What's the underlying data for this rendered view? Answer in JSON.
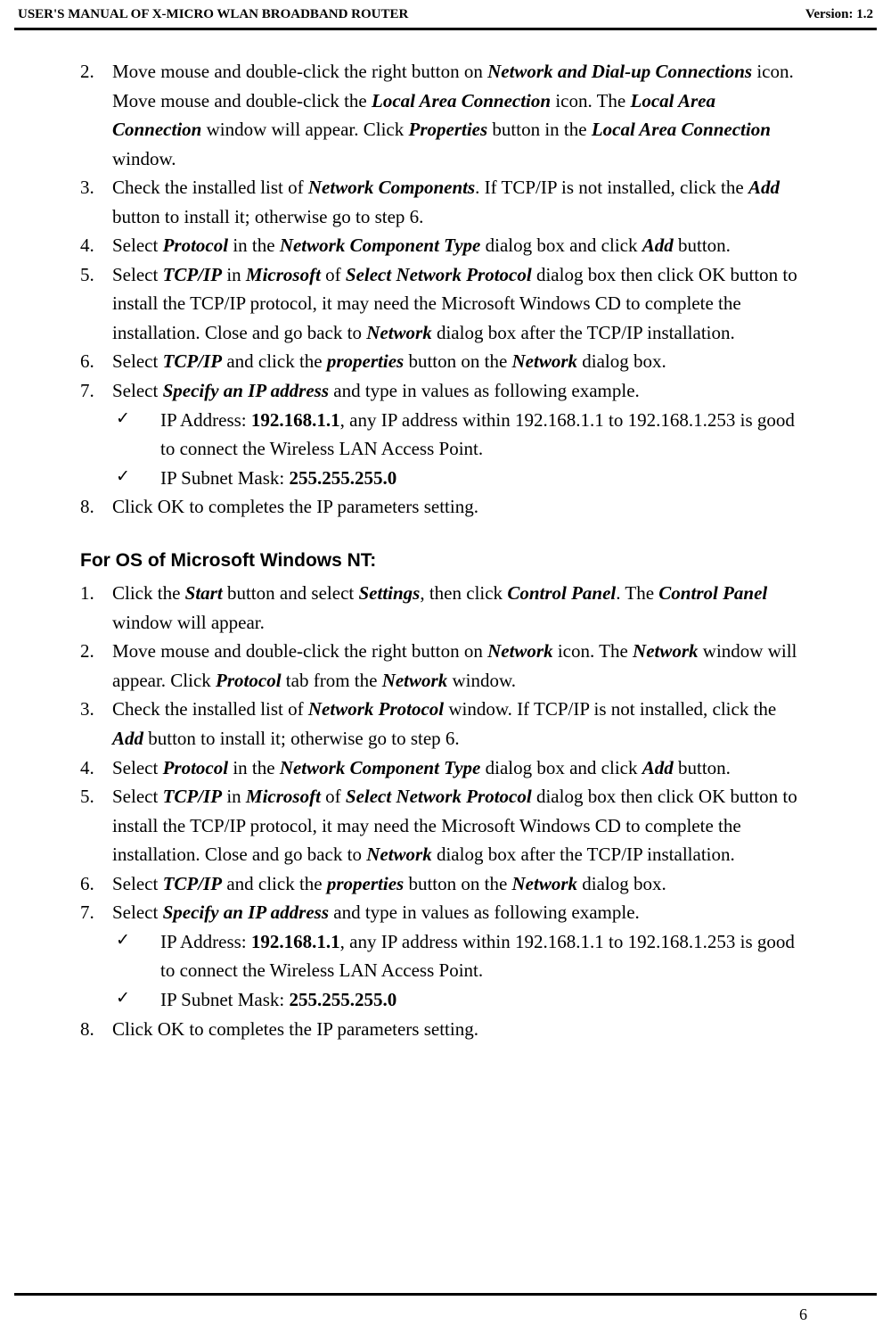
{
  "header": {
    "left": "USER'S MANUAL OF X-MICRO WLAN BROADBAND ROUTER",
    "right": "Version: 1.2"
  },
  "topList": {
    "items": [
      {
        "num": "2.",
        "parts": [
          {
            "t": "Move mouse and double-click the right button on "
          },
          {
            "t": "Network and Dial-up Connections",
            "bi": true
          },
          {
            "t": " icon. Move mouse and double-click the "
          },
          {
            "t": "Local Area Connection",
            "bi": true
          },
          {
            "t": " icon. The "
          },
          {
            "t": "Local Area Connection",
            "bi": true
          },
          {
            "t": " window will appear. Click "
          },
          {
            "t": "Properties",
            "bi": true
          },
          {
            "t": " button in the "
          },
          {
            "t": "Local Area Connection",
            "bi": true
          },
          {
            "t": " window."
          }
        ]
      },
      {
        "num": "3.",
        "parts": [
          {
            "t": "Check the installed list of "
          },
          {
            "t": "Network Components",
            "bi": true
          },
          {
            "t": ". If TCP/IP is not installed, click the "
          },
          {
            "t": "Add",
            "bi": true
          },
          {
            "t": " button to install it; otherwise go to step 6."
          }
        ]
      },
      {
        "num": "4.",
        "parts": [
          {
            "t": "Select "
          },
          {
            "t": "Protocol",
            "bi": true
          },
          {
            "t": " in the "
          },
          {
            "t": "Network Component Type",
            "bi": true
          },
          {
            "t": " dialog box and click "
          },
          {
            "t": "Add",
            "bi": true
          },
          {
            "t": " button."
          }
        ]
      },
      {
        "num": "5.",
        "parts": [
          {
            "t": "Select "
          },
          {
            "t": "TCP/IP",
            "bi": true
          },
          {
            "t": " in "
          },
          {
            "t": "Microsoft",
            "bi": true
          },
          {
            "t": " of "
          },
          {
            "t": "Select Network Protocol",
            "bi": true
          },
          {
            "t": " dialog box then click OK button to install the TCP/IP protocol, it may need the Microsoft Windows CD to complete the installation. Close and go back to "
          },
          {
            "t": "Network",
            "bi": true
          },
          {
            "t": " dialog box after the TCP/IP installation."
          }
        ]
      },
      {
        "num": "6.",
        "parts": [
          {
            "t": "Select "
          },
          {
            "t": "TCP/IP",
            "bi": true
          },
          {
            "t": " and click the "
          },
          {
            "t": "properties",
            "bi": true
          },
          {
            "t": " button on the "
          },
          {
            "t": "Network",
            "bi": true
          },
          {
            "t": " dialog box."
          }
        ]
      },
      {
        "num": "7.",
        "parts": [
          {
            "t": "Select "
          },
          {
            "t": "Specify an IP address",
            "bi": true
          },
          {
            "t": " and type in values as following example."
          }
        ],
        "sub": [
          {
            "parts": [
              {
                "t": "IP Address: "
              },
              {
                "t": "192.168.1.1",
                "b": true
              },
              {
                "t": ", any IP address within 192.168.1.1 to 192.168.1.253 is good to connect the Wireless LAN Access Point."
              }
            ]
          },
          {
            "parts": [
              {
                "t": "IP Subnet Mask: "
              },
              {
                "t": "255.255.255.0",
                "b": true
              }
            ]
          }
        ]
      },
      {
        "num": "8.",
        "parts": [
          {
            "t": "Click OK to completes the IP parameters setting."
          }
        ]
      }
    ]
  },
  "sectionTitle": "For OS of Microsoft Windows NT:",
  "ntList": {
    "items": [
      {
        "num": "1.",
        "parts": [
          {
            "t": "Click the "
          },
          {
            "t": "Start",
            "bi": true
          },
          {
            "t": " button and select "
          },
          {
            "t": "Settings",
            "bi": true
          },
          {
            "t": ", then click "
          },
          {
            "t": "Control Panel",
            "bi": true
          },
          {
            "t": ". The "
          },
          {
            "t": "Control Panel",
            "bi": true
          },
          {
            "t": " window will appear."
          }
        ]
      },
      {
        "num": "2.",
        "parts": [
          {
            "t": "Move mouse and double-click the right button on "
          },
          {
            "t": "Network",
            "bi": true
          },
          {
            "t": " icon. The "
          },
          {
            "t": "Network",
            "bi": true
          },
          {
            "t": " window will appear. Click "
          },
          {
            "t": "Protocol",
            "bi": true
          },
          {
            "t": " tab from the "
          },
          {
            "t": "Network",
            "bi": true
          },
          {
            "t": " window."
          }
        ]
      },
      {
        "num": "3.",
        "parts": [
          {
            "t": "Check the installed list of "
          },
          {
            "t": "Network Protocol",
            "bi": true
          },
          {
            "t": " window. If TCP/IP is not installed, click the "
          },
          {
            "t": "Add",
            "bi": true
          },
          {
            "t": " button to install it; otherwise go to step 6."
          }
        ]
      },
      {
        "num": "4.",
        "parts": [
          {
            "t": "Select "
          },
          {
            "t": "Protocol",
            "bi": true
          },
          {
            "t": " in the "
          },
          {
            "t": "Network Component Type",
            "bi": true
          },
          {
            "t": " dialog box and click "
          },
          {
            "t": "Add",
            "bi": true
          },
          {
            "t": " button."
          }
        ]
      },
      {
        "num": "5.",
        "parts": [
          {
            "t": "Select "
          },
          {
            "t": "TCP/IP",
            "bi": true
          },
          {
            "t": " in "
          },
          {
            "t": "Microsoft",
            "bi": true
          },
          {
            "t": " of "
          },
          {
            "t": "Select Network Protocol",
            "bi": true
          },
          {
            "t": " dialog box then click OK button to install the TCP/IP protocol, it may need the Microsoft Windows CD to complete the installation. Close and go back to "
          },
          {
            "t": "Network",
            "bi": true
          },
          {
            "t": " dialog box after the TCP/IP installation."
          }
        ]
      },
      {
        "num": "6.",
        "parts": [
          {
            "t": "Select "
          },
          {
            "t": "TCP/IP",
            "bi": true
          },
          {
            "t": " and click the "
          },
          {
            "t": "properties",
            "bi": true
          },
          {
            "t": " button on the "
          },
          {
            "t": "Network",
            "bi": true
          },
          {
            "t": " dialog box."
          }
        ]
      },
      {
        "num": "7.",
        "parts": [
          {
            "t": "Select "
          },
          {
            "t": "Specify an IP address",
            "bi": true
          },
          {
            "t": " and type in values as following example."
          }
        ],
        "sub": [
          {
            "parts": [
              {
                "t": "IP Address: "
              },
              {
                "t": "192.168.1.1",
                "b": true
              },
              {
                "t": ", any IP address within 192.168.1.1 to 192.168.1.253 is good to connect the Wireless LAN Access Point."
              }
            ]
          },
          {
            "parts": [
              {
                "t": "IP Subnet Mask: "
              },
              {
                "t": "255.255.255.0",
                "b": true
              }
            ]
          }
        ]
      },
      {
        "num": "8.",
        "parts": [
          {
            "t": "Click OK to completes the IP parameters setting."
          }
        ]
      }
    ]
  },
  "checkmark": "✓",
  "pageNumber": "6"
}
